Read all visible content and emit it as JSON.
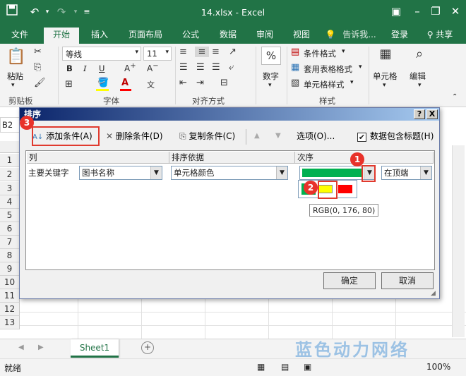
{
  "window": {
    "title": "14.xlsx - Excel"
  },
  "tabs": [
    "文件",
    "开始",
    "插入",
    "页面布局",
    "公式",
    "数据",
    "审阅",
    "视图"
  ],
  "tell_me": "告诉我...",
  "login": "登录",
  "share": "共享",
  "ribbon": {
    "paste": "粘贴",
    "clipboard": "剪贴板",
    "font_name": "等线",
    "font_size": "11",
    "font_group": "字体",
    "align_group": "对齐方式",
    "number_label": "数字",
    "percent": "%",
    "cond_format": "条件格式",
    "table_format": "套用表格格式",
    "cell_style": "单元格样式",
    "style_group": "样式",
    "cells": "单元格",
    "edit": "编辑",
    "bold": "B",
    "italic": "I",
    "underline": "U"
  },
  "namebox": "B2",
  "rows": [
    "1",
    "2",
    "3",
    "4",
    "5",
    "6",
    "7",
    "8",
    "9",
    "10",
    "11",
    "12",
    "13"
  ],
  "sheet_tab": "Sheet1",
  "status": {
    "ready": "就绪",
    "zoom": "100%"
  },
  "dialog": {
    "title": "排序",
    "add_level": "添加条件(A)",
    "delete_level": "删除条件(D)",
    "copy_level": "复制条件(C)",
    "options": "选项(O)...",
    "has_headers": "数据包含标题(H)",
    "col_header": "列",
    "sort_on_header": "排序依据",
    "order_header": "次序",
    "row_label": "主要关键字",
    "column_value": "图书名称",
    "sort_on_value": "单元格颜色",
    "position_value": "在顶端",
    "tooltip": "RGB(0, 176, 80)",
    "ok": "确定",
    "cancel": "取消",
    "help": "?",
    "close": "X"
  },
  "callouts": [
    "1",
    "2",
    "3"
  ],
  "swatches": {
    "selected": "#00b050",
    "yellow": "#ffff00",
    "red": "#ff0000"
  },
  "watermark": "蓝色动力网络"
}
